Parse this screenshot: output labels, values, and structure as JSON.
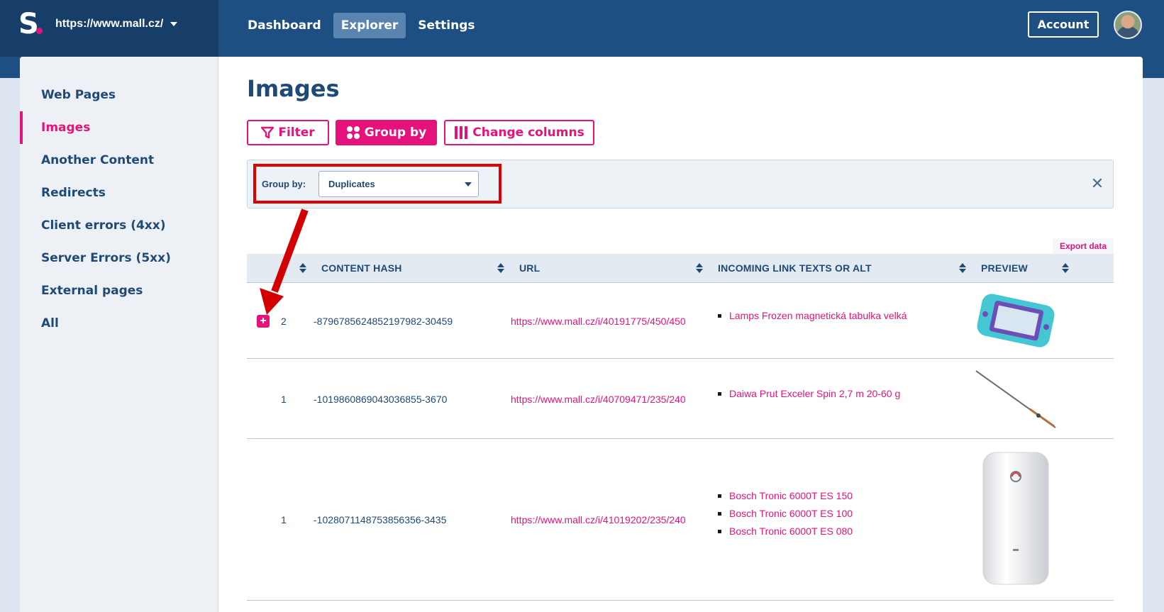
{
  "header": {
    "site": "https://www.mall.cz/",
    "nav": [
      "Dashboard",
      "Explorer",
      "Settings"
    ],
    "active_nav": "Explorer",
    "account_label": "Account",
    "brand_color": "#1d4f82",
    "accent_color": "#e6127b"
  },
  "sidebar": {
    "items": [
      {
        "label": "Web Pages"
      },
      {
        "label": "Images"
      },
      {
        "label": "Another Content"
      },
      {
        "label": "Redirects"
      },
      {
        "label": "Client errors (4xx)"
      },
      {
        "label": "Server Errors (5xx)"
      },
      {
        "label": "External pages"
      },
      {
        "label": "All"
      }
    ],
    "active": "Images"
  },
  "main": {
    "title": "Images",
    "buttons": {
      "filter": "Filter",
      "group_by": "Group by",
      "change_columns": "Change columns"
    },
    "group": {
      "label": "Group by:",
      "value": "Duplicates"
    },
    "export_label": "Export data"
  },
  "table": {
    "columns": [
      "CONTENT HASH",
      "URL",
      "INCOMING LINK TEXTS OR ALT",
      "PREVIEW"
    ],
    "rows": [
      {
        "count": "2",
        "hash": "-8796785624852197982-30459",
        "url": "https://www.mall.cz/i/40191775/450/450",
        "alts": [
          "Lamps Frozen magnetická tabulka velká"
        ],
        "preview": "magnetic drawing board"
      },
      {
        "count": "1",
        "hash": "-1019860869043036855-3670",
        "url": "https://www.mall.cz/i/40709471/235/240",
        "alts": [
          "Daiwa Prut Exceler Spin 2,7 m 20-60 g"
        ],
        "preview": "fishing rod"
      },
      {
        "count": "1",
        "hash": "-1028071148753856356-3435",
        "url": "https://www.mall.cz/i/41019202/235/240",
        "alts": [
          "Bosch Tronic 6000T ES 150",
          "Bosch Tronic 6000T ES 100",
          "Bosch Tronic 6000T ES 080"
        ],
        "preview": "water heater"
      }
    ]
  }
}
